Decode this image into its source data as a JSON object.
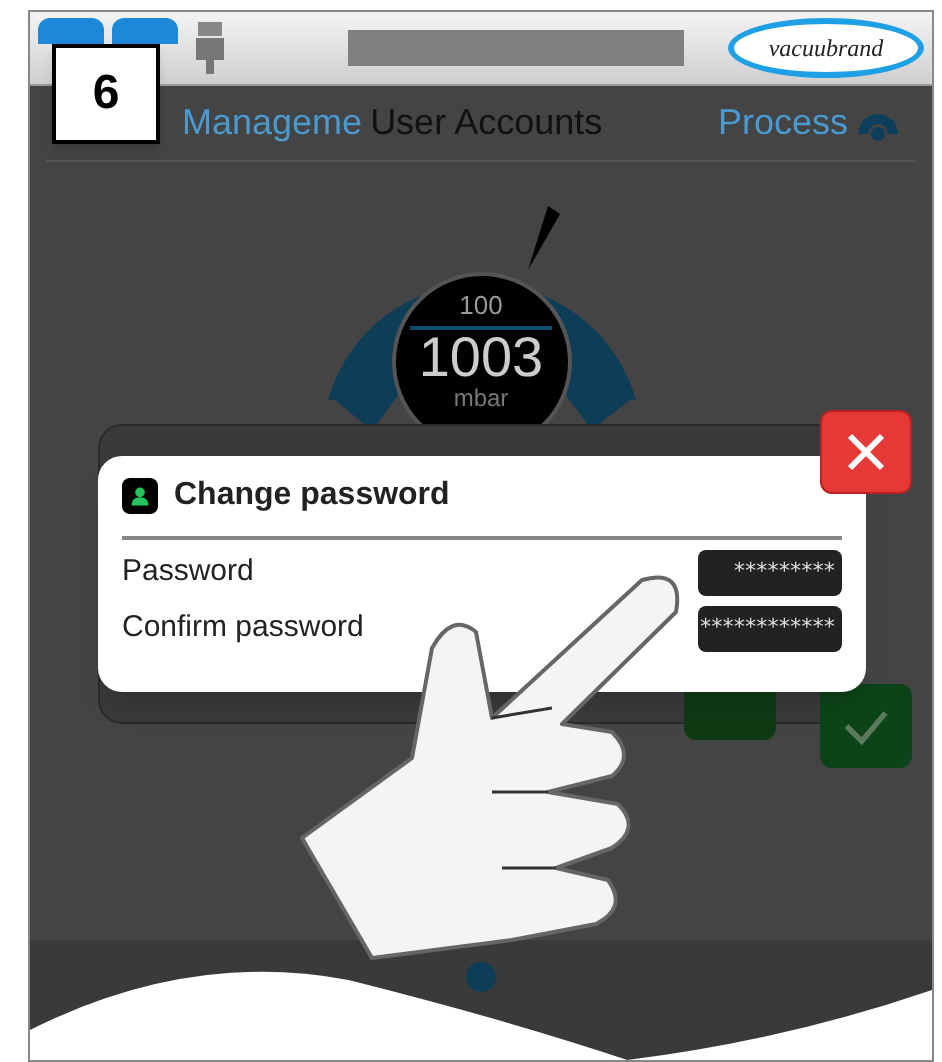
{
  "header": {
    "logo": "vacuubrand"
  },
  "step": "6",
  "nav": {
    "left": "Manageme",
    "title": "User Accounts",
    "right": "Process"
  },
  "gauge": {
    "setpoint": "100",
    "value": "1003",
    "unit": "mbar"
  },
  "dialog": {
    "title": "Change password",
    "fields": [
      {
        "label": "Password",
        "value": "*********"
      },
      {
        "label": "Confirm password",
        "value": "************"
      }
    ]
  }
}
